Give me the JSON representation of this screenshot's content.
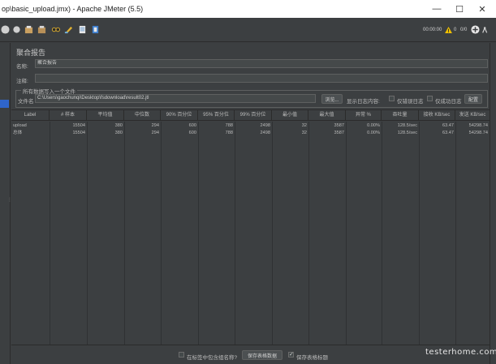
{
  "window": {
    "title": "op\\basic_upload.jmx) - Apache JMeter (5.5)",
    "controls": {
      "minimize": "—",
      "maximize": "☐",
      "close": "✕"
    }
  },
  "toolbar": {
    "timer": "00:00:00",
    "warning_count": "0",
    "threads": "0/0",
    "icons": [
      "start-icon",
      "start-no-timers-icon",
      "stop-icon",
      "shutdown-icon",
      "clear-icon",
      "clear-all-icon",
      "search-icon",
      "reset-search-icon",
      "function-helper-icon",
      "help-icon"
    ]
  },
  "panel": {
    "title": "聚合报告",
    "name_label": "名称:",
    "name_value": "聚合报告",
    "comment_label": "注释:",
    "comment_value": "",
    "group_title": "所有数据写入一个文件",
    "file_label": "文件名",
    "file_value": "C:\\Users\\gaochunqi\\Desktop\\fsdownload\\result02.jtl",
    "browse_button": "浏览...",
    "log_display_label": "显示日志内容:",
    "errors_only_label": "仅错误日志",
    "success_only_label": "仅成功日志",
    "configure_button": "配置"
  },
  "table": {
    "columns": [
      "Label",
      "# 样本",
      "平均值",
      "中位数",
      "90% 百分位",
      "95% 百分位",
      "99% 百分位",
      "最小值",
      "最大值",
      "异常 %",
      "吞吐量",
      "接收 KB/sec",
      "发送 KB/sec"
    ],
    "rows": [
      [
        "upload",
        "15504",
        "380",
        "294",
        "600",
        "788",
        "2498",
        "32",
        "3587",
        "0.00%",
        "128.5/sec",
        "63.47",
        "54298.74"
      ],
      [
        "总体",
        "15504",
        "380",
        "294",
        "600",
        "788",
        "2498",
        "32",
        "3587",
        "0.00%",
        "128.5/sec",
        "63.47",
        "54298.74"
      ]
    ]
  },
  "bottom": {
    "include_group_label": "在标签中包含组名称?",
    "save_table_button": "保存表格数据",
    "save_header_label": "保存表格标题",
    "include_group_checked": false,
    "save_header_checked": true
  },
  "watermark": "testerhome.com",
  "colors": {
    "background": "#3c3f41",
    "selection": "#2f65ca",
    "warning": "#f0c000"
  }
}
